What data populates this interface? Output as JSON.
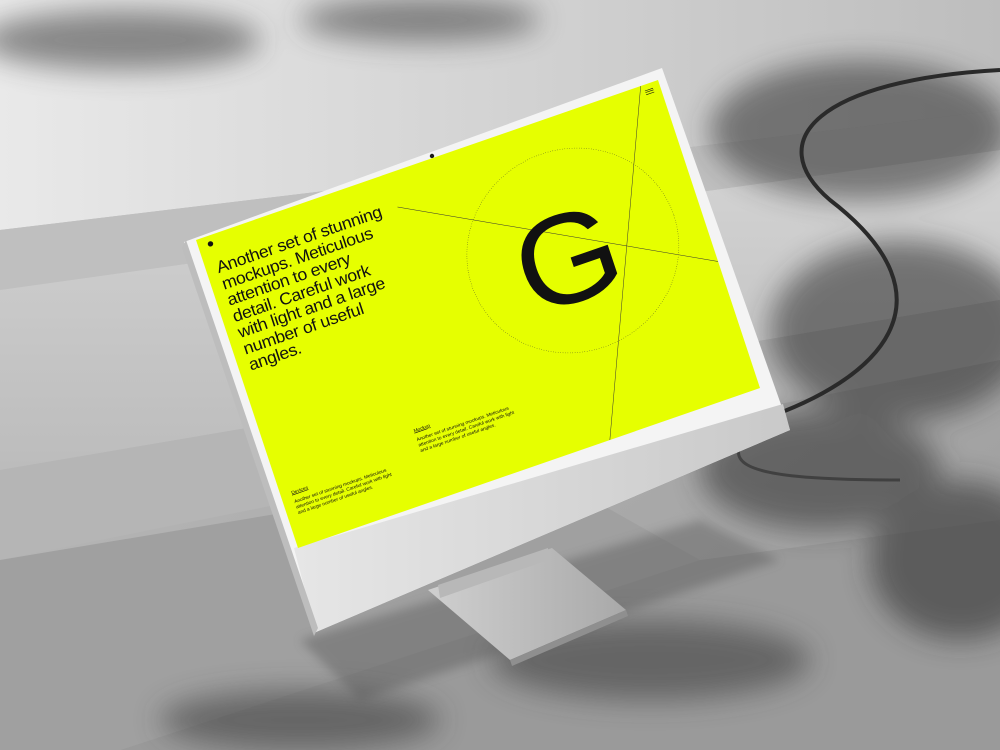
{
  "screen": {
    "brand": "",
    "login": "",
    "headline": "Another set of stunning mockups. Meticulous attention to every detail. Careful work with light and a large number of useful angles.",
    "big_letter": "G",
    "columns": [
      {
        "title": "Devices",
        "text": "Another set of stunning mockups. Meticulous attention to every detail. Careful work with light and a large number of useful angles."
      },
      {
        "title": "Mockup",
        "text": "Another set of stunning mockups. Meticulous attention to every detail. Careful work with light and a large number of useful angles."
      }
    ]
  },
  "colors": {
    "screen_background": "#e6ff00",
    "monitor_silver": "#dcdcdc",
    "ink": "#111111"
  },
  "icons": [
    "webcam-icon",
    "menu-icon",
    "logo-dot-icon"
  ]
}
